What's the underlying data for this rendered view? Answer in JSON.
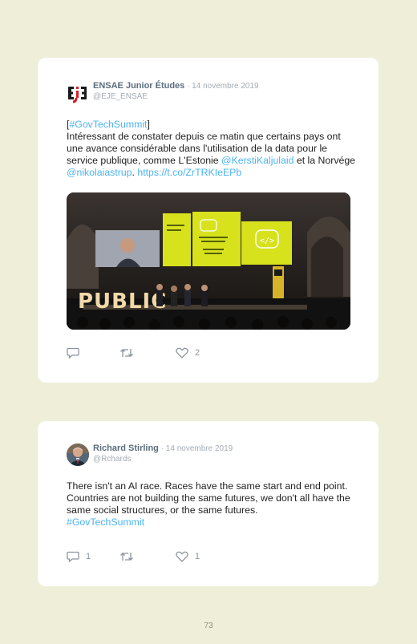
{
  "tweets": [
    {
      "author": "ENSAE Junior Études",
      "date": " · 14 novembre 2019",
      "handle": "@EJE_ENSAE",
      "avatar_text": "EJE",
      "text": {
        "bracket_open": "[",
        "hashtag": "#GovTechSummit",
        "bracket_close": "]",
        "body": "Intéressant de constater depuis ce matin que certains pays ont une avance considérable dans l'utilisation de la data pour le service publique, comme L'Estonie ",
        "mention1": "@KerstiKaljulaid",
        "middle": " et la Norvége ",
        "mention2": "@nikolaiastrup",
        "dot": ". ",
        "url": "https://t.co/ZrTRKIeEPb"
      },
      "photo": {
        "stage_letters": "PUBLIC",
        "slide_icon": "</>"
      },
      "actions": {
        "reply_count": "",
        "retweet_count": "",
        "like_count": "2"
      }
    },
    {
      "author": "Richard Stirling",
      "date": " · 14 novembre 2019",
      "handle": "@Rchards",
      "text": {
        "body": "There isn't an AI race. Races have the same start and end point. Countries are not building the same futures, we don't all have the same social structures, or the same futures.",
        "hashtag": "#GovTechSummit"
      },
      "actions": {
        "reply_count": "1",
        "retweet_count": "",
        "like_count": "1"
      }
    }
  ],
  "page_number": "73",
  "colors": {
    "background": "#efefd9",
    "link": "#4ab3f4",
    "name": "#5a6d7d",
    "meta": "#a3acb5",
    "slide_yellow": "#d7e21d"
  },
  "icons": [
    "reply-icon",
    "retweet-icon",
    "heart-icon"
  ]
}
